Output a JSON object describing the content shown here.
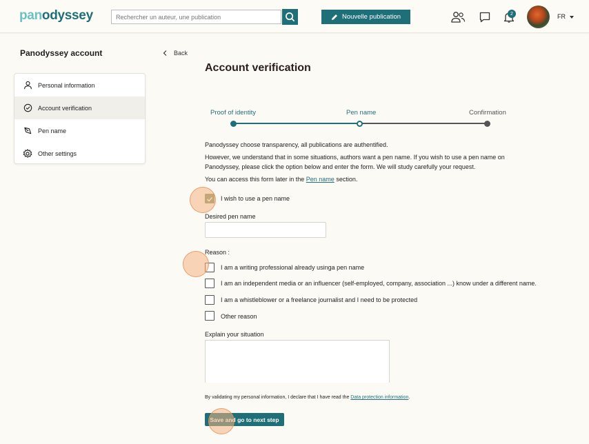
{
  "header": {
    "logo_part1": "pan",
    "logo_part2": "odyssey",
    "search_placeholder": "Rechercher un auteur, une publication",
    "new_publication_label": "Nouvelle publication",
    "notification_count": "2",
    "language": "FR"
  },
  "sidebar": {
    "title": "Panodyssey account",
    "items": [
      {
        "label": "Personal information",
        "icon": "person-icon"
      },
      {
        "label": "Account verification",
        "icon": "check-circle-icon"
      },
      {
        "label": "Pen name",
        "icon": "pen-nib-icon"
      },
      {
        "label": "Other settings",
        "icon": "gear-icon"
      }
    ],
    "active_index": 1
  },
  "main": {
    "back_label": "Back",
    "title": "Account verification",
    "steps": [
      {
        "label": "Proof of identity",
        "state": "done"
      },
      {
        "label": "Pen name",
        "state": "current"
      },
      {
        "label": "Confirmation",
        "state": "pending"
      }
    ],
    "intro1": "Panodyssey choose transparency, all publications are authentified.",
    "intro2": "However, we understand that in some situations, authors want a pen name. If you wish to use a pen name on Panodyssey, please click the option below and enter the form. We will study carefully your request.",
    "access_prefix": "You can access this form later in the",
    "access_link": "Pen name",
    "access_suffix": "section.",
    "wish_label": "I wish to use a pen name",
    "wish_checked": true,
    "desired_label": "Desired pen name",
    "desired_value": "",
    "reason_label": "Reason :",
    "reasons": [
      {
        "label": "I am a writing professional already usinga pen name",
        "checked": false
      },
      {
        "label": "I am an independent media or an influencer (self-employed, company, association ...) know under a different name.",
        "checked": false
      },
      {
        "label": "I am a whistleblower or a freelance journalist and I need to be protected",
        "checked": false
      },
      {
        "label": "Other reason",
        "checked": false
      }
    ],
    "explain_label": "Explain your situation",
    "explain_value": "",
    "declaration_prefix": "By validating my personal information, I declare that I have read the",
    "declaration_link": "Data protection information",
    "declaration_suffix": ".",
    "save_label": "Save and go to next step"
  },
  "colors": {
    "accent": "#1f6f78",
    "logo_light": "#6cc1c4",
    "step_pending": "#555555",
    "background": "#fcfaf5"
  }
}
